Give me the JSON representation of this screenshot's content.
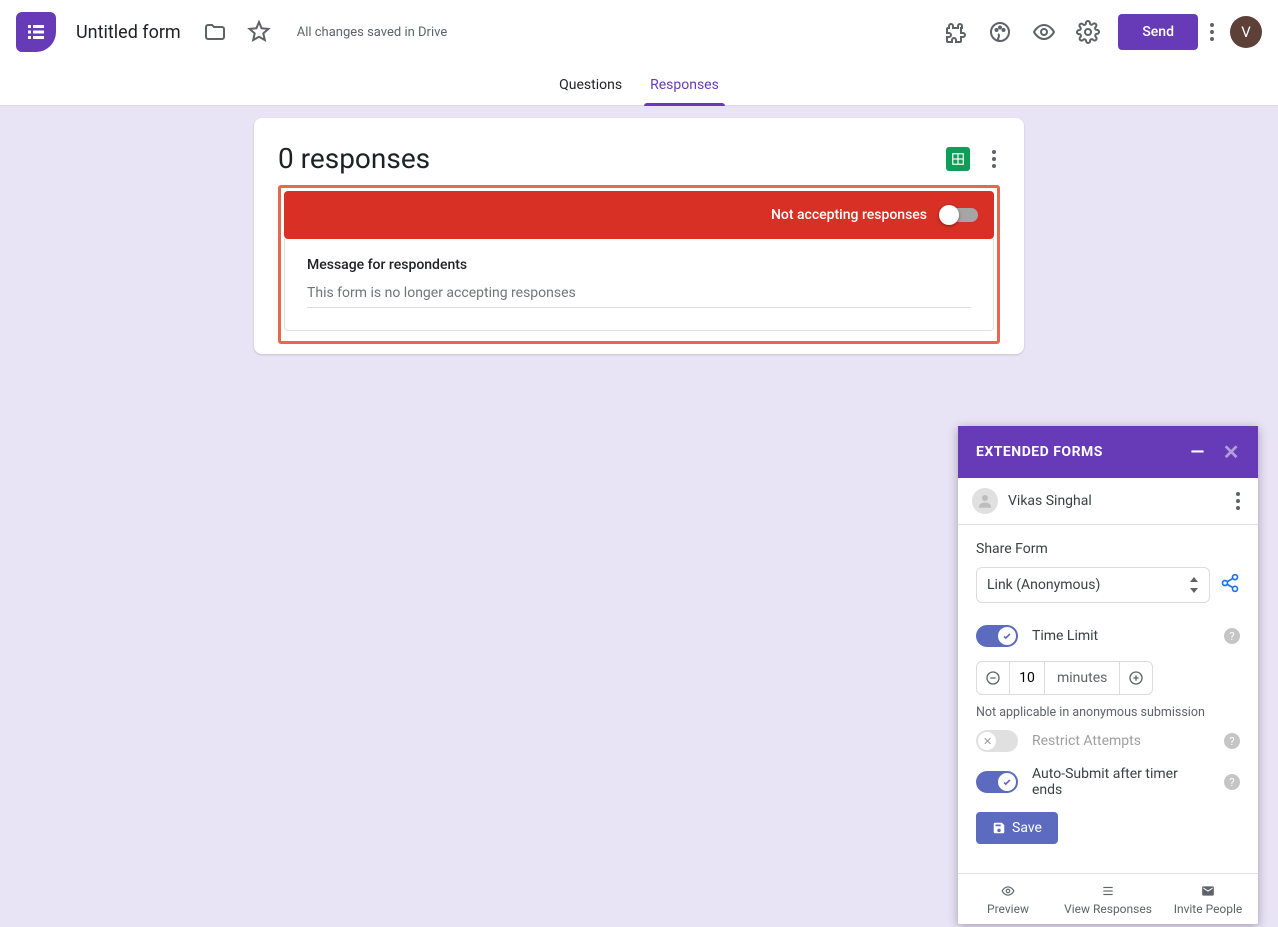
{
  "header": {
    "title": "Untitled form",
    "saved": "All changes saved in Drive",
    "send": "Send",
    "avatar": "V"
  },
  "tabs": {
    "questions": "Questions",
    "responses": "Responses"
  },
  "responses": {
    "title": "0 responses",
    "banner": "Not accepting responses",
    "msg_label": "Message for respondents",
    "msg_text": "This form is no longer accepting responses"
  },
  "ext": {
    "title": "EXTENDED FORMS",
    "user": "Vikas Singhal",
    "share_label": "Share Form",
    "share_value": "Link (Anonymous)",
    "time_limit": "Time Limit",
    "time_value": "10",
    "time_unit": "minutes",
    "note": "Not applicable in anonymous submission",
    "restrict": "Restrict Attempts",
    "auto_submit": "Auto-Submit after timer ends",
    "save": "Save",
    "footer": {
      "preview": "Preview",
      "view": "View Responses",
      "invite": "Invite People"
    }
  }
}
